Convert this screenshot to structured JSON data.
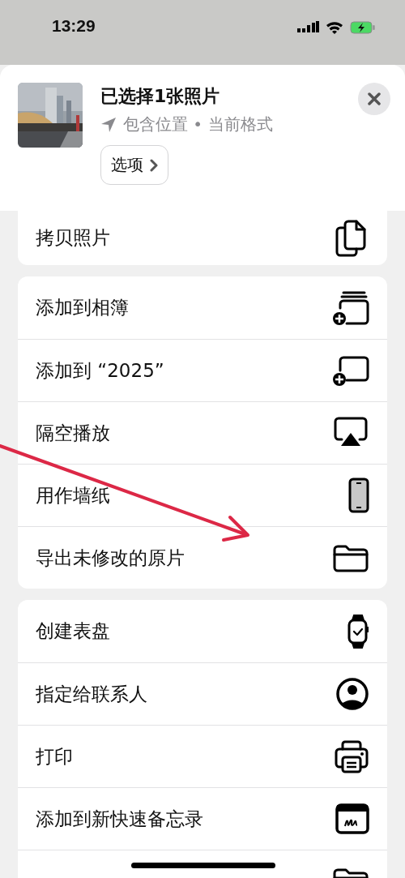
{
  "status_bar": {
    "time": "13:29"
  },
  "share_header": {
    "title": "已选择1张照片",
    "subtitle": "包含位置 • 当前格式",
    "options_button": "选项"
  },
  "action_groups": [
    {
      "actions": [
        {
          "label": "拷贝照片",
          "kind": "copy"
        }
      ]
    },
    {
      "actions": [
        {
          "label": "添加到相簿",
          "kind": "albums"
        },
        {
          "label": "添加到 “2025”",
          "kind": "album"
        },
        {
          "label": "隔空播放",
          "kind": "airplay"
        },
        {
          "label": "用作墙纸",
          "kind": "wallpaper"
        },
        {
          "label": "导出未修改的原片",
          "kind": "export"
        }
      ]
    },
    {
      "actions": [
        {
          "label": "创建表盘",
          "kind": "watchface"
        },
        {
          "label": "指定给联系人",
          "kind": "contact"
        },
        {
          "label": "打印",
          "kind": "print"
        },
        {
          "label": "添加到新快速备忘录",
          "kind": "note"
        },
        {
          "kind": "export"
        }
      ]
    }
  ],
  "annotation": {
    "kind": "arrow",
    "color": "#dc2846"
  }
}
